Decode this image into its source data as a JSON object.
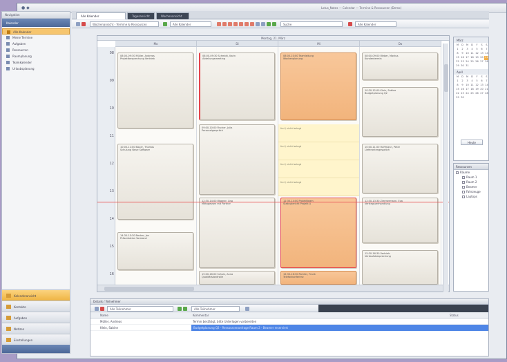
{
  "window": {
    "title": "Lotus_Notes — Calendar — Termine & Ressourcen (Demo)"
  },
  "nav": {
    "header": "Navigation",
    "subheader": "Kalender",
    "tree": [
      {
        "label": "Alle Kalender",
        "selected": true
      },
      {
        "label": "Meine Termine",
        "selected": false
      },
      {
        "label": "Aufgaben",
        "selected": false
      },
      {
        "label": "Ressourcen",
        "selected": false
      },
      {
        "label": "Raumplanung",
        "selected": false
      },
      {
        "label": "Teamkalender",
        "selected": false
      },
      {
        "label": "Urlaubsplanung",
        "selected": false
      }
    ],
    "buttons": [
      {
        "label": "Kalenderansicht",
        "active": true
      },
      {
        "label": "Kontakte",
        "active": false
      },
      {
        "label": "Aufgaben",
        "active": false
      },
      {
        "label": "Notizen",
        "active": false
      },
      {
        "label": "Einstellungen",
        "active": false
      }
    ]
  },
  "tabs": [
    {
      "label": "Alle Kalender"
    },
    {
      "label": "Tagesansicht"
    },
    {
      "label": "Wochenansicht"
    }
  ],
  "toolbar": {
    "view_field": "Wochenansicht - Termine & Ressourcen",
    "filter_field": "Alle Kalender",
    "search_field": "Suche"
  },
  "calendar": {
    "date_bar": "Montag, 21. März",
    "days": [
      "Mo",
      "Di",
      "Mi",
      "Do"
    ],
    "times": [
      "08",
      "09",
      "10",
      "11",
      "12",
      "13",
      "14",
      "15",
      "16"
    ],
    "appointments": [
      {
        "l1": "08:00-09:30 Müller, Andreas",
        "l2": "Projektbesprechung Vertrieb"
      },
      {
        "l1": "08:00-09:30 Schmidt, Karin",
        "l2": "Abteilungsmeeting"
      },
      {
        "l1": "08:00-10:00 Teamleitung",
        "l2": "Wochenplanung"
      },
      {
        "l1": "08:00-09:00 Weber, Markus",
        "l2": "Kundentermin"
      },
      {
        "l1": "10:00-11:00 Bauer, Thomas",
        "l2": "Schulung Neue Software"
      },
      {
        "l1": "09:00-10:00 Fischer, Julia",
        "l2": "Personalgespräch"
      },
      {
        "l1": "10:30-12:00 Klein, Sabine",
        "l2": "Budgetplanung Q2"
      },
      {
        "l1": "10:00-11:00 Hoffmann, Peter",
        "l2": "Lieferantengespräch"
      },
      {
        "l1": "12:30-14:00 Wagner, Lisa",
        "l2": "Mittagessen mit Partner"
      },
      {
        "l1": "12:30-14:00 Projektteam",
        "l2": "Statusbericht Projekt A"
      },
      {
        "l1": "12:30-13:30 Zimmermann, Eva",
        "l2": "Vertragsverhandlung"
      },
      {
        "l1": "14:30-15:30 Becker, Jan",
        "l2": "Präsentation Vorstand"
      },
      {
        "l1": "15:00-16:00 Schulz, Anna",
        "l2": "Qualitätskontrolle"
      },
      {
        "l1": "15:30-16:30 Richter, Frank",
        "l2": "Telefonkonferenz"
      },
      {
        "l1": "15:30-16:30 Vertrieb",
        "l2": "Verkaufsbesprechung"
      }
    ],
    "free_slots": [
      "frei / nicht belegt",
      "frei / nicht belegt",
      "frei / nicht belegt",
      "frei / nicht belegt"
    ]
  },
  "minical": {
    "months": [
      {
        "label": "März",
        "cells": [
          "M",
          "D",
          "M",
          "D",
          "F",
          "S",
          "S",
          "1",
          "2",
          "3",
          "4",
          "5",
          "6",
          "7",
          "8",
          "9",
          "10",
          "11",
          "12",
          "13",
          "14",
          "15",
          "16",
          "17",
          "18",
          "19",
          "20",
          "21",
          "22",
          "23",
          "24",
          "25",
          "26",
          "27",
          "28",
          "29",
          "30",
          "31"
        ]
      },
      {
        "label": "April",
        "cells": [
          "M",
          "D",
          "M",
          "D",
          "F",
          "S",
          "S",
          "1",
          "2",
          "3",
          "4",
          "5",
          "6",
          "7",
          "8",
          "9",
          "10",
          "11",
          "12",
          "13",
          "14",
          "15",
          "16",
          "17",
          "18",
          "19",
          "20",
          "21",
          "22",
          "23",
          "24",
          "25",
          "26",
          "27",
          "28",
          "29",
          "30"
        ]
      }
    ],
    "today_button": "Heute"
  },
  "resources": {
    "header": "Ressourcen",
    "nodes": [
      {
        "label": "Räume",
        "child": false
      },
      {
        "label": "Raum 1",
        "child": true
      },
      {
        "label": "Raum 2",
        "child": true
      },
      {
        "label": "Beamer",
        "child": true
      },
      {
        "label": "Fahrzeuge",
        "child": true
      },
      {
        "label": "Laptops",
        "child": true
      }
    ]
  },
  "details": {
    "header": "Details / Teilnehmer",
    "filter_text": "Alle Teilnehmer",
    "columns": [
      "Name",
      "Kommentar",
      "Status"
    ],
    "rows": [
      {
        "name": "Müller, Andreas",
        "comment": "Termin bestätigt, bitte Unterlagen vorbereiten",
        "selected": false
      },
      {
        "name": "Klein, Sabine",
        "comment": "Budgetplanung Q2 - Ressourcenanfrage Raum 2 - Beamer reserviert",
        "selected": true
      }
    ]
  }
}
